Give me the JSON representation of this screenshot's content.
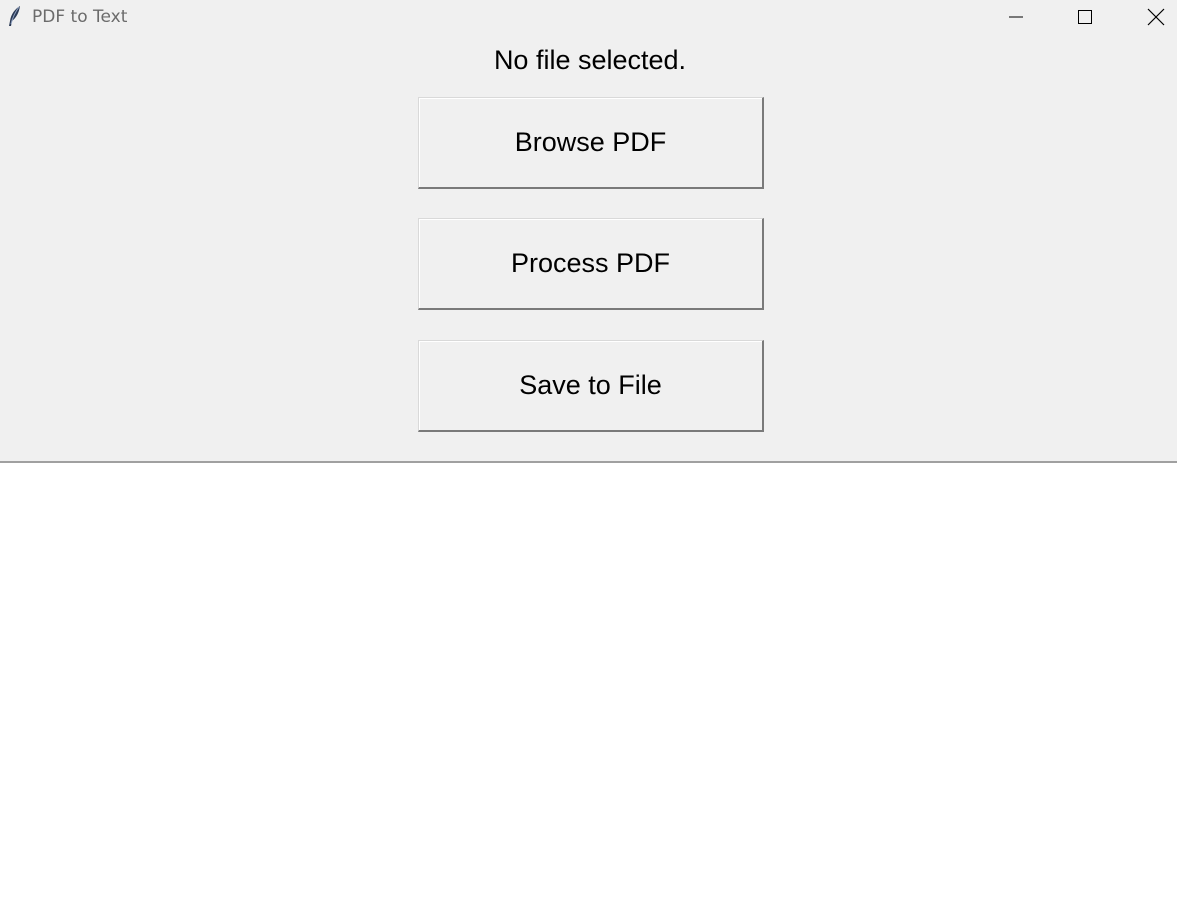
{
  "window": {
    "title": "PDF to Text",
    "icon": "feather-icon"
  },
  "controls": {
    "minimize_icon": "minimize-icon",
    "maximize_icon": "maximize-icon",
    "close_icon": "close-icon"
  },
  "status": {
    "text": "No file selected."
  },
  "buttons": {
    "browse_label": "Browse PDF",
    "process_label": "Process PDF",
    "save_label": "Save to File"
  },
  "output": {
    "text": ""
  },
  "colors": {
    "panel_background": "#f0f0f0",
    "output_background": "#ffffff",
    "button_shadow": "#7a7a7a"
  }
}
